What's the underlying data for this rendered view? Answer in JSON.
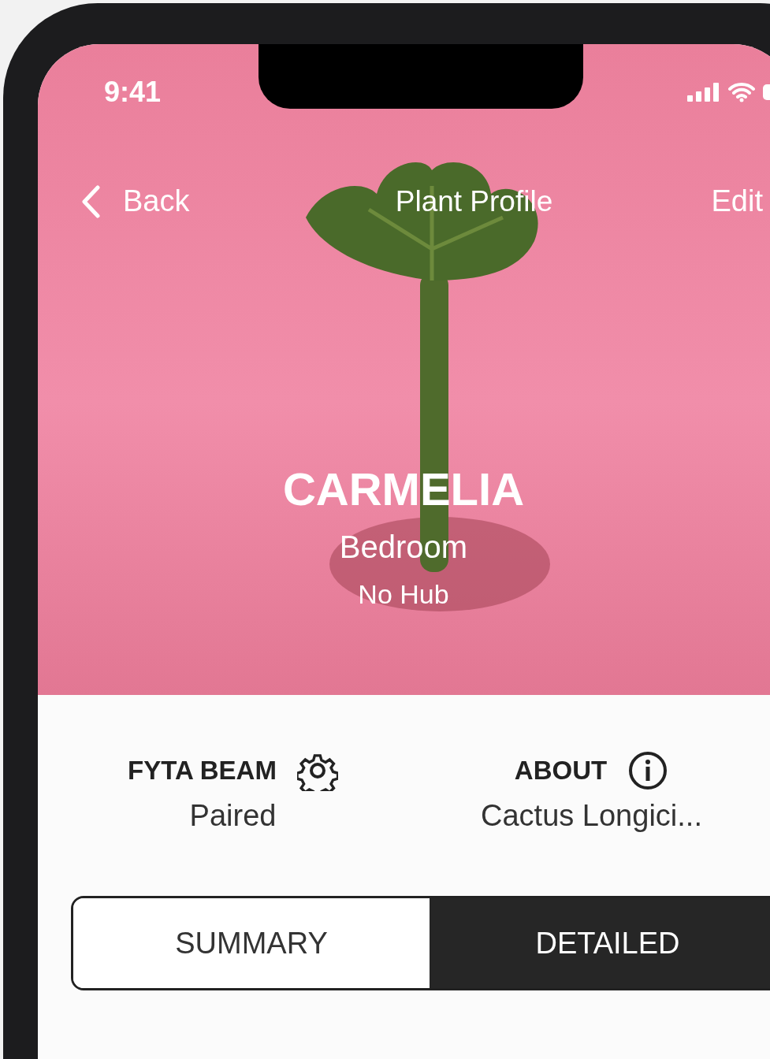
{
  "status_bar": {
    "time": "9:41"
  },
  "nav": {
    "back": "Back",
    "title": "Plant Profile",
    "edit": "Edit"
  },
  "plant": {
    "name": "CARMELIA",
    "room": "Bedroom",
    "hub": "No Hub"
  },
  "info": [
    {
      "label": "FYTA BEAM",
      "value": "Paired",
      "kind": "settings"
    },
    {
      "label": "ABOUT",
      "value": "Cactus Longici...",
      "kind": "info"
    }
  ],
  "tabs": [
    {
      "label": "SUMMARY",
      "selected": false
    },
    {
      "label": "DETAILED",
      "selected": true
    }
  ]
}
